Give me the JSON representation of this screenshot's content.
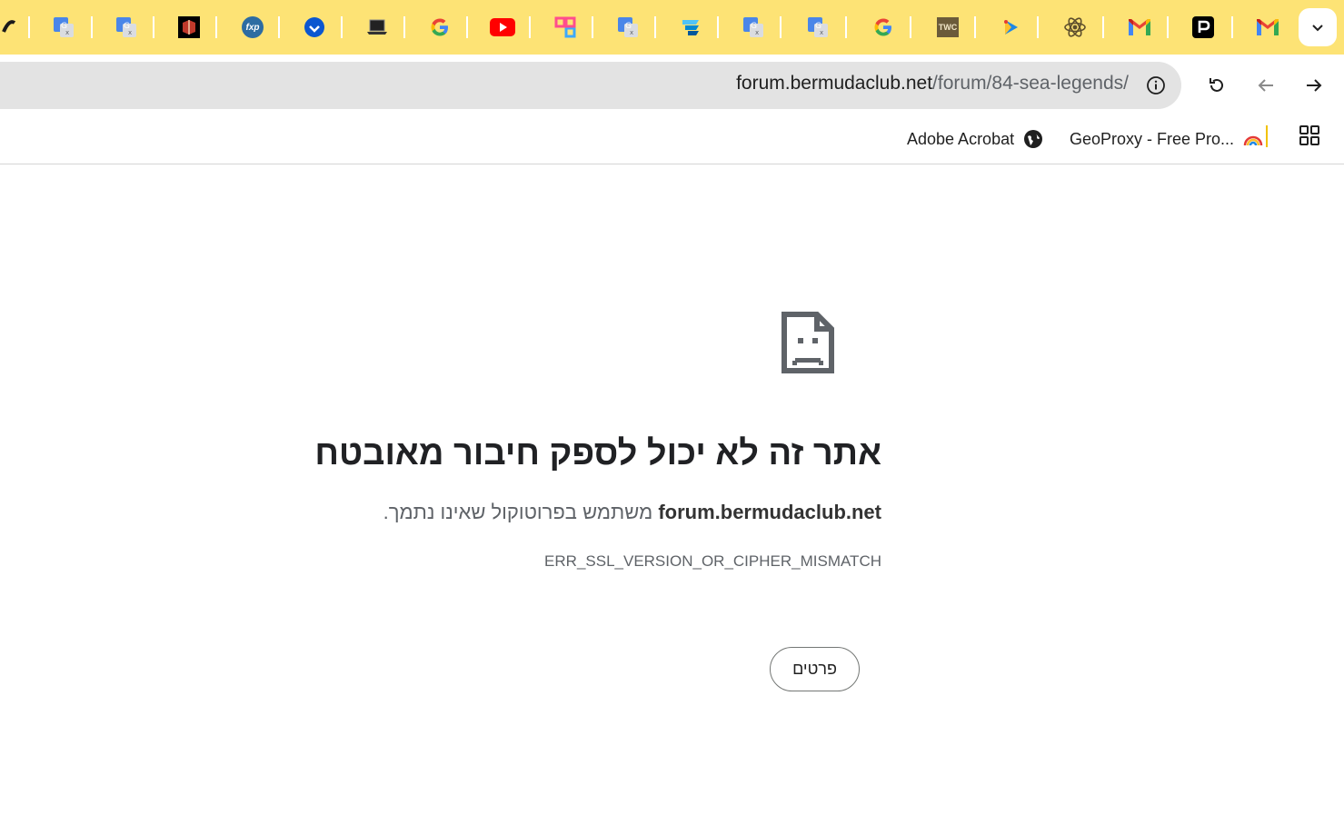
{
  "tabs": [
    {
      "icon": "partial-tab-icon"
    },
    {
      "icon": "google-translate-icon"
    },
    {
      "icon": "google-translate-icon"
    },
    {
      "icon": "box-logo-icon"
    },
    {
      "icon": "fxp-icon",
      "label": "fxp"
    },
    {
      "icon": "blue-check-circle-icon"
    },
    {
      "icon": "laptop-icon"
    },
    {
      "icon": "google-g-icon"
    },
    {
      "icon": "youtube-icon"
    },
    {
      "icon": "pink-app-icon"
    },
    {
      "icon": "google-translate-icon"
    },
    {
      "icon": "blue-stack-icon"
    },
    {
      "icon": "google-translate-icon"
    },
    {
      "icon": "google-translate-icon"
    },
    {
      "icon": "google-g-icon"
    },
    {
      "icon": "twc-icon",
      "label": "TWC"
    },
    {
      "icon": "play-arrow-icon"
    },
    {
      "icon": "atom-icon"
    },
    {
      "icon": "gmail-icon"
    },
    {
      "icon": "black-p-icon"
    },
    {
      "icon": "gmail-icon"
    }
  ],
  "toolbar": {
    "url_domain": "forum.bermudaclub.net",
    "url_path": "/forum/84-sea-legends/",
    "site_info_icon": "info-icon",
    "reload_icon": "reload-icon",
    "back_icon": "back-arrow-icon",
    "forward_icon": "forward-arrow-icon"
  },
  "bookmarks": [
    {
      "label": "Adobe Acrobat",
      "icon": "globe-icon"
    },
    {
      "label": "GeoProxy - Free Pro...",
      "icon": "rainbow-icon"
    }
  ],
  "apps_icon": "apps-grid-icon",
  "error": {
    "icon": "sad-page-icon",
    "title": "אתר זה לא יכול לספק חיבור מאובטח",
    "domain": "forum.bermudaclub.net",
    "description": " משתמש בפרוטוקול שאינו נתמך.",
    "code": "ERR_SSL_VERSION_OR_CIPHER_MISMATCH",
    "details_button": "פרטים"
  },
  "colors": {
    "tabstrip": "#fde375",
    "omnibox": "#e3e3e3",
    "text": "#202124",
    "muted": "#5f6368"
  }
}
